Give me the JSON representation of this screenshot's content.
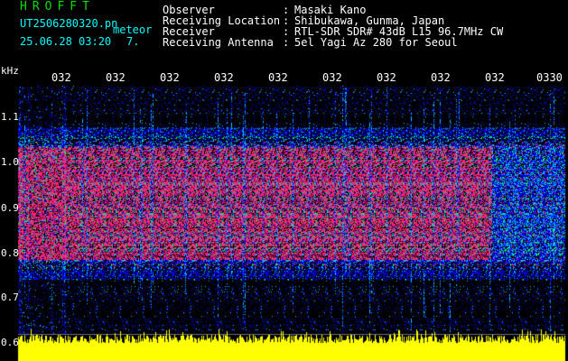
{
  "header": {
    "logo": "HROFFT",
    "file_label": "UT2506280320.pn",
    "tag": "meteor",
    "datetime": "25.06.28 03:20",
    "seven": "7.",
    "info_rows": [
      {
        "label": "Observer",
        "value": "Masaki Kano"
      },
      {
        "label": "Receiving Location",
        "value": "Shibukawa, Gunma, Japan"
      },
      {
        "label": "Receiver",
        "value": "RTL-SDR SDR# 43dB L15 96.7MHz CW"
      },
      {
        "label": "Receiving Antenna",
        "value": "5el Yagi Az 280 for Seoul"
      }
    ]
  },
  "spectrogram": {
    "y_unit": "kHz",
    "y_ticks": [
      "1.1",
      "1.0",
      "0.9",
      "0.8",
      "0.7",
      "0.6"
    ],
    "x_ticks": [
      "032",
      "032",
      "032",
      "032",
      "032",
      "032",
      "032",
      "032",
      "032",
      "0330"
    ],
    "colors": {
      "background": "#000000",
      "noise_low": "#0000ff",
      "noise_mid": "#00c8ff",
      "echo_mid": "#00ff60",
      "echo_high": "#ff2070",
      "power_bar": "#ffff00"
    }
  }
}
